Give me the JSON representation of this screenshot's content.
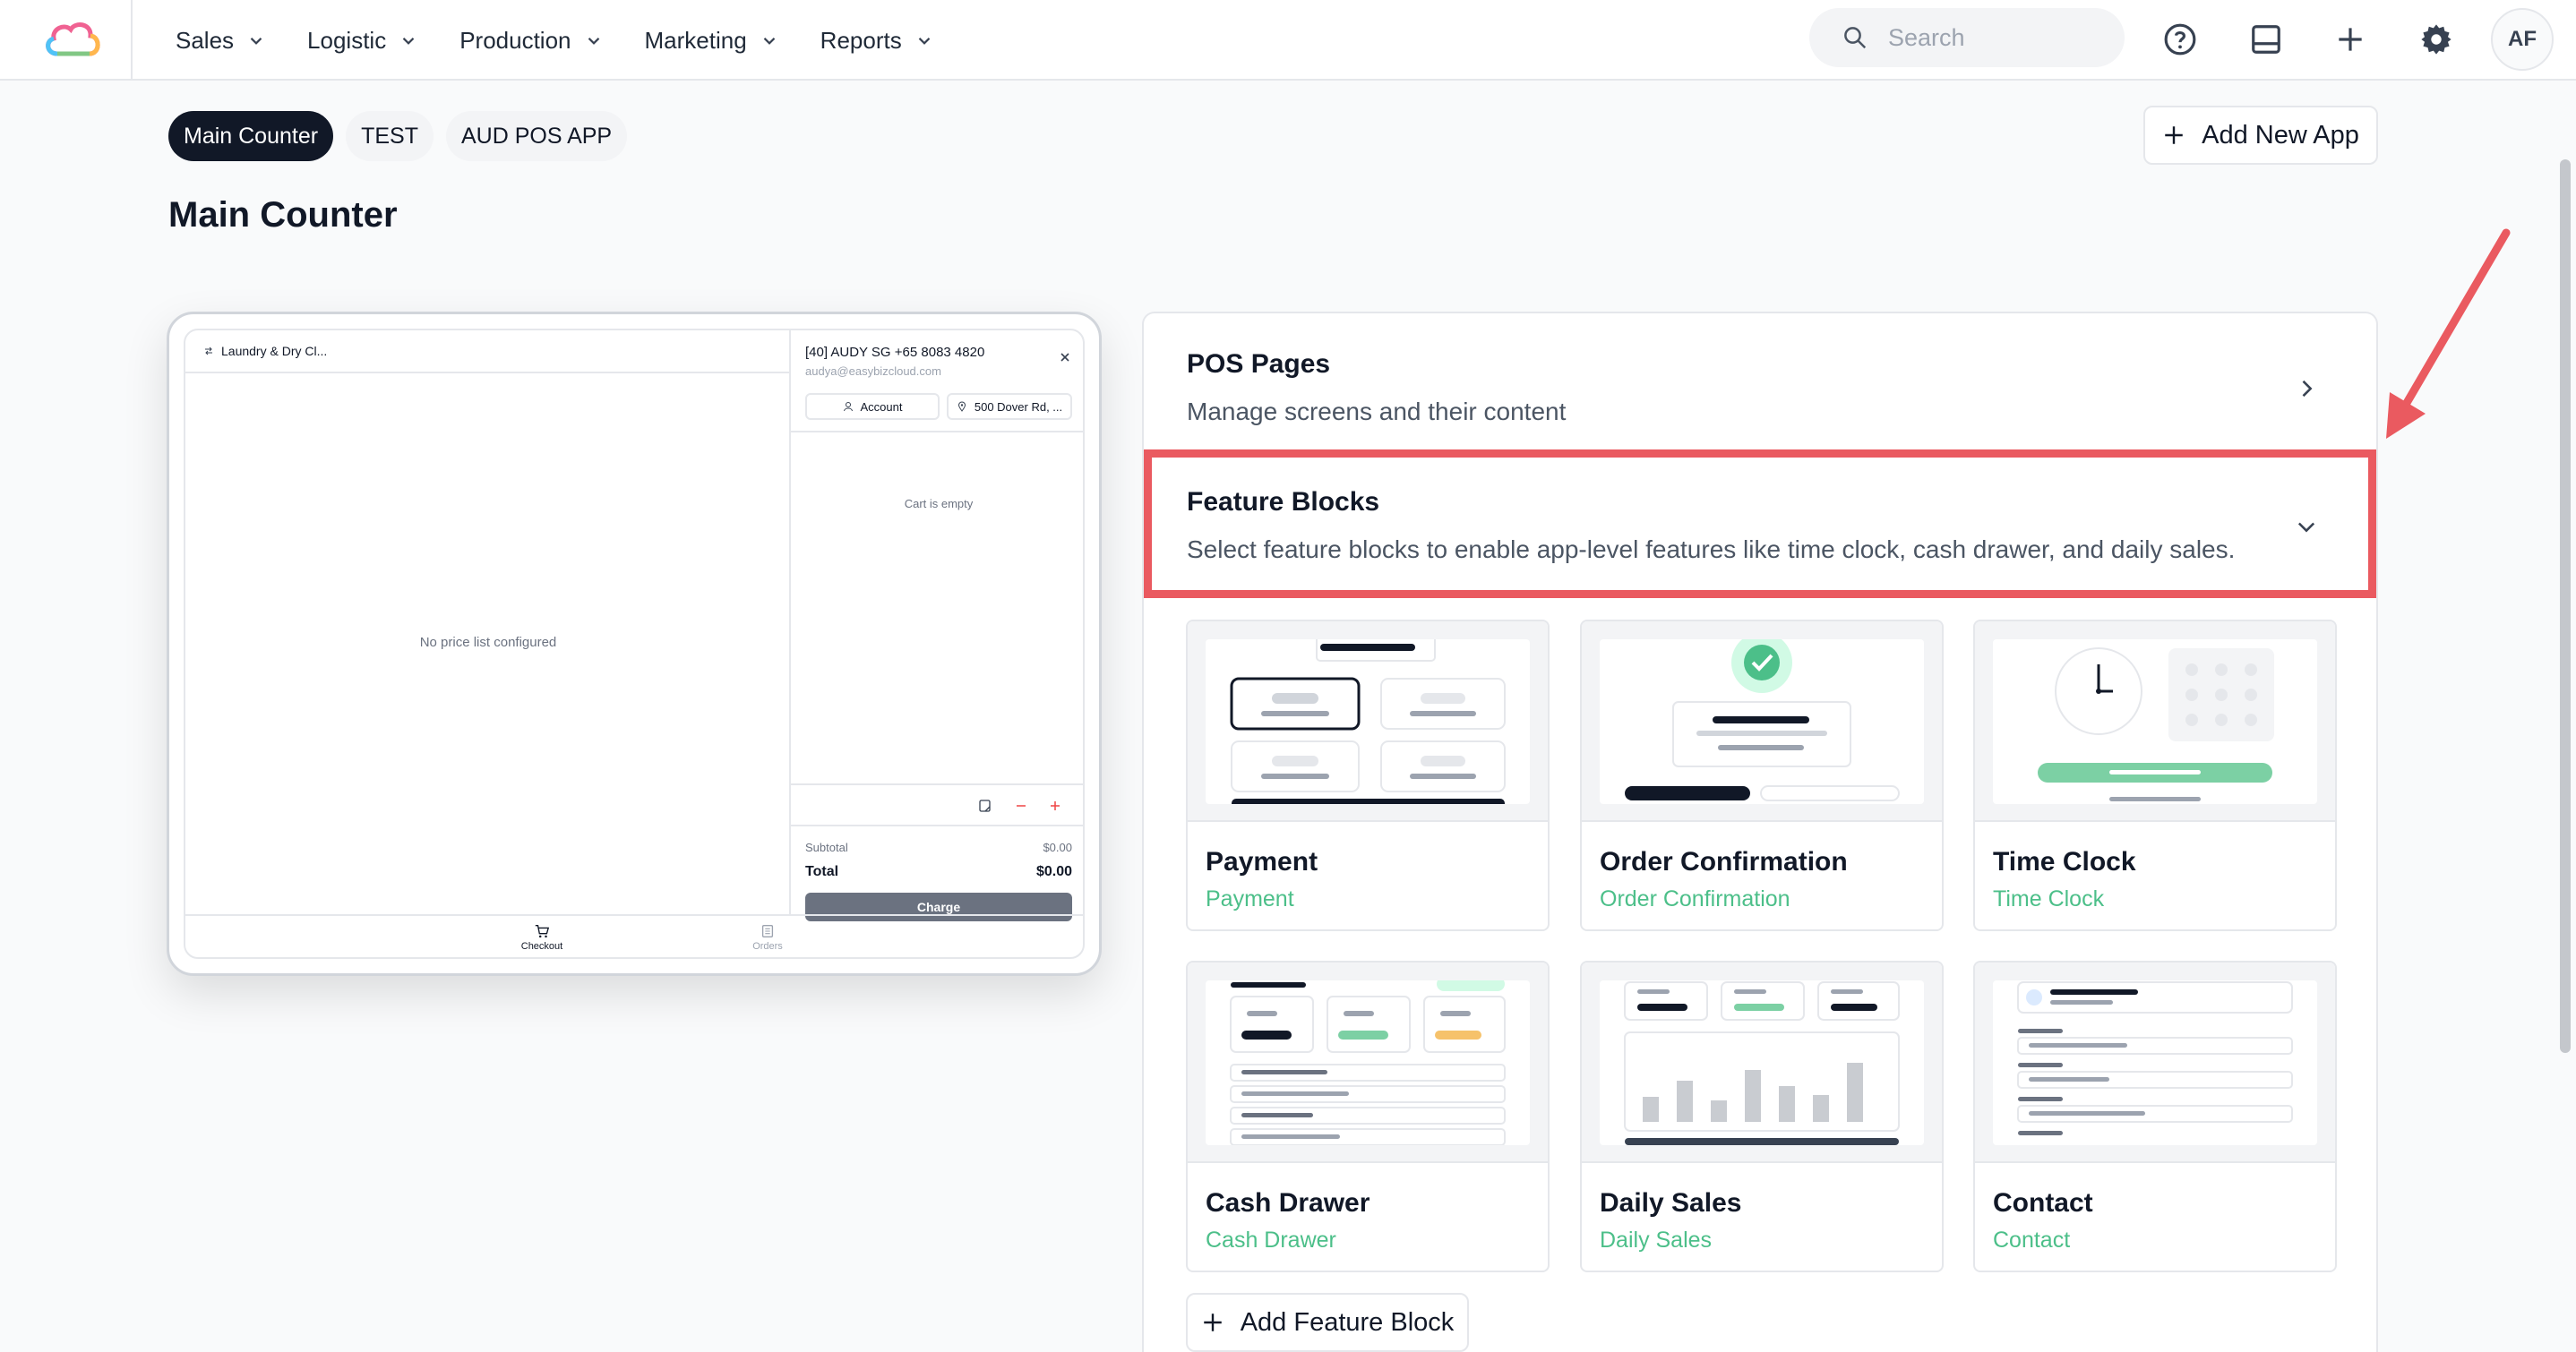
{
  "nav": {
    "items": [
      {
        "label": "Sales"
      },
      {
        "label": "Logistic"
      },
      {
        "label": "Production"
      },
      {
        "label": "Marketing"
      },
      {
        "label": "Reports"
      }
    ],
    "search_placeholder": "Search",
    "avatar_initials": "AF"
  },
  "tabs": [
    {
      "label": "Main Counter",
      "active": true
    },
    {
      "label": "TEST",
      "active": false
    },
    {
      "label": "AUD POS APP",
      "active": false
    }
  ],
  "add_app_label": "Add New App",
  "page_title": "Main Counter",
  "preview": {
    "store_label": "Laundry & Dry Cl...",
    "empty_price": "No price list configured",
    "customer_name": "[40] AUDY SG +65 8083 4820",
    "customer_email": "audya@easybizcloud.com",
    "account_label": "Account",
    "address_label": "500 Dover Rd, ...",
    "cart_empty": "Cart is empty",
    "subtotal_label": "Subtotal",
    "subtotal_value": "$0.00",
    "total_label": "Total",
    "total_value": "$0.00",
    "charge_label": "Charge",
    "bottom_tabs": [
      {
        "label": "Checkout"
      },
      {
        "label": "Orders"
      }
    ]
  },
  "sections": {
    "pos_pages": {
      "title": "POS Pages",
      "description": "Manage screens and their content"
    },
    "feature_blocks": {
      "title": "Feature Blocks",
      "description": "Select feature blocks to enable app-level features like time clock, cash drawer, and daily sales."
    }
  },
  "features": [
    {
      "name": "Payment",
      "subtitle": "Payment"
    },
    {
      "name": "Order Confirmation",
      "subtitle": "Order Confirmation"
    },
    {
      "name": "Time Clock",
      "subtitle": "Time Clock"
    },
    {
      "name": "Cash Drawer",
      "subtitle": "Cash Drawer"
    },
    {
      "name": "Daily Sales",
      "subtitle": "Daily Sales"
    },
    {
      "name": "Contact",
      "subtitle": "Contact"
    }
  ],
  "add_feature_label": "Add Feature Block",
  "colors": {
    "accent_green": "#4cbf89",
    "highlight_red": "#ea5a60",
    "dark": "#111827"
  }
}
